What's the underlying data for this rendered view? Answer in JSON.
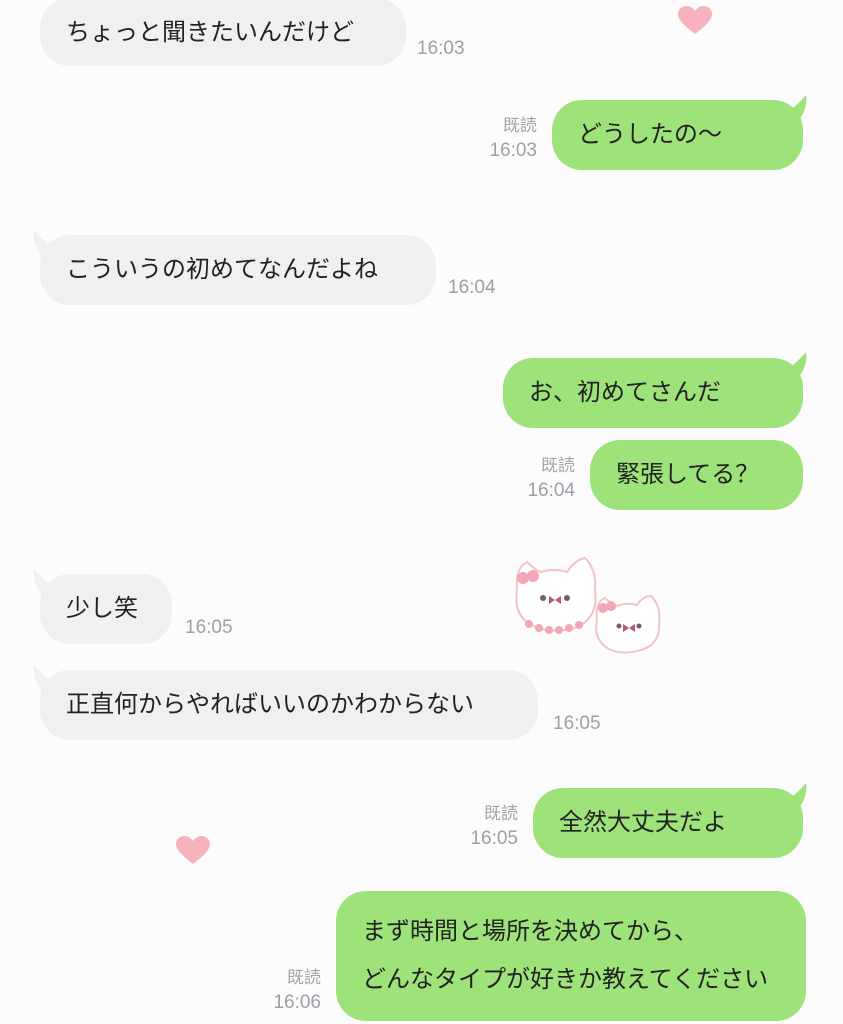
{
  "messages": [
    {
      "text": "ちょっと聞きたいんだけど",
      "time": "16:03"
    },
    {
      "text": "どうしたの〜",
      "read": "既読",
      "time": "16:03"
    },
    {
      "text": "こういうの初めてなんだよね",
      "time": "16:04"
    },
    {
      "text": "お、初めてさんだ"
    },
    {
      "text": "緊張してる？",
      "read": "既読",
      "time": "16:04"
    },
    {
      "text": "少し笑",
      "time": "16:05"
    },
    {
      "text": "正直何からやればいいのかわからない",
      "time": "16:05"
    },
    {
      "text": "全然大丈夫だよ",
      "read": "既読",
      "time": "16:05"
    },
    {
      "line1": "まず時間と場所を決めてから、",
      "line2": "どんなタイプが好きか教えてください",
      "read": "既読",
      "time": "16:06"
    }
  ],
  "colors": {
    "incoming_bubble": "#f0f0f1",
    "outgoing_bubble": "#9ee27a",
    "timestamp": "#9aa0a6",
    "heart": "#f6b3bd"
  },
  "icons": [
    "heart-sticker-icon",
    "cat-sticker-icon"
  ]
}
